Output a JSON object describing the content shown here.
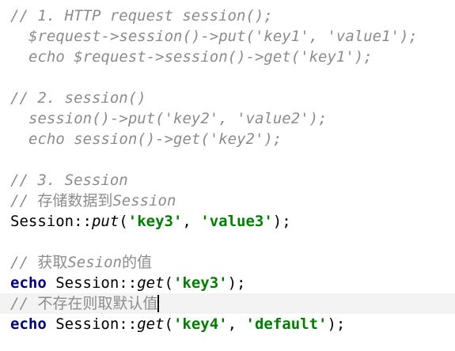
{
  "section1": {
    "comment": "// 1. HTTP request session();",
    "line_put": "$request->session()->put('key1', 'value1');",
    "line_get": "echo $request->session()->get('key1');"
  },
  "section2": {
    "comment": "// 2. session()",
    "line_put": "session()->put('key2', 'value2');",
    "line_get": "echo session()->get('key2');"
  },
  "section3": {
    "comment": "// 3. Session",
    "comment_store_prefix": "// ",
    "comment_store_cjk": "存储数据到",
    "comment_store_suffix": "Session",
    "put_line": {
      "class": "Session",
      "op": "::",
      "method": "put",
      "open": "(",
      "arg1": "'key3'",
      "sep": ", ",
      "arg2": "'value3'",
      "close": ");"
    },
    "comment_get_prefix": "// ",
    "comment_get_cjk1": "获取",
    "comment_get_word": "Sesion",
    "comment_get_cjk2": "的值",
    "get_line": {
      "keyword": "echo",
      "class": "Session",
      "op": "::",
      "method": "get",
      "open": "(",
      "arg1": "'key3'",
      "close": ");"
    },
    "comment_default_prefix": "// ",
    "comment_default_cjk": "不存在则取默认值",
    "default_line": {
      "keyword": "echo",
      "class": "Session",
      "op": "::",
      "method": "get",
      "open": "(",
      "arg1": "'key4'",
      "sep": ", ",
      "arg2": "'default'",
      "close": ");"
    }
  }
}
